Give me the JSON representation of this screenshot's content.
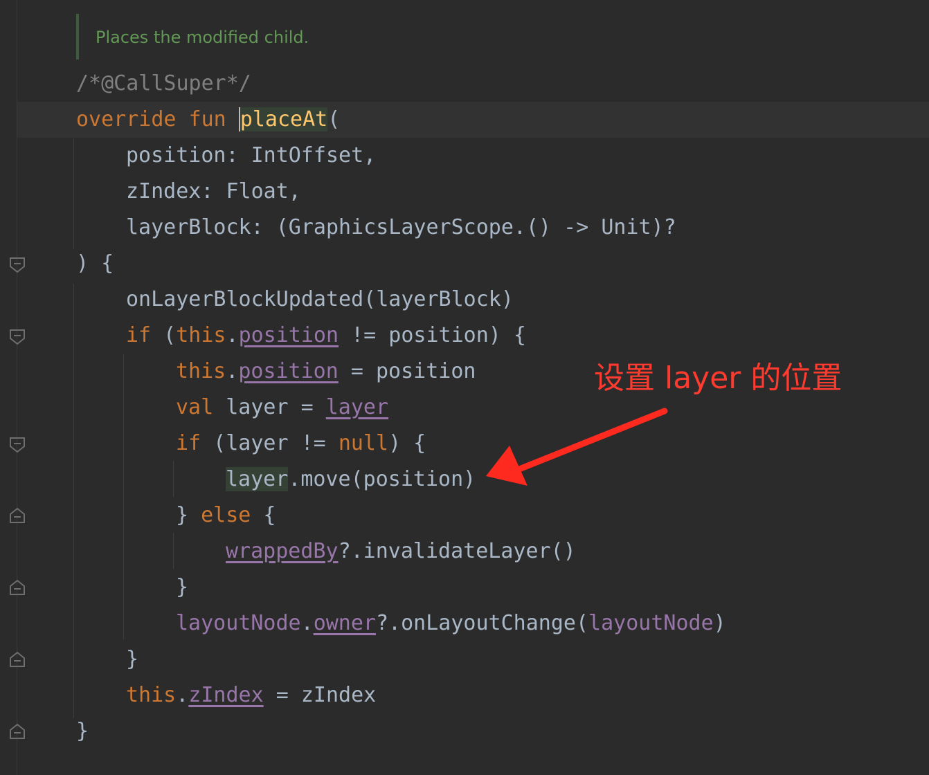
{
  "doc": {
    "text": "Places the modified child."
  },
  "code": {
    "l1_comment": "/*@CallSuper*/",
    "l2_kw1": "override",
    "l2_kw2": "fun",
    "l2_fn": "placeAt",
    "l2_paren": "(",
    "l3": "position: IntOffset,",
    "l4": "zIndex: Float,",
    "l5": "layerBlock: (GraphicsLayerScope.() -> Unit)?",
    "l6": ") {",
    "l7": "onLayerBlockUpdated(layerBlock)",
    "l8_if": "if",
    "l8_paren": " (",
    "l8_this": "this",
    "l8_dot": ".",
    "l8_prop": "position",
    "l8_rest": " != position) {",
    "l9_this": "this",
    "l9_dot": ".",
    "l9_prop": "position",
    "l9_rest": " = position",
    "l10_val": "val",
    "l10_mid": " layer = ",
    "l10_prop": "layer",
    "l11_if": "if",
    "l11_mid": " (layer != ",
    "l11_null": "null",
    "l11_rest": ") {",
    "l12_layer": "layer",
    "l12_rest": ".move(position)",
    "l13_brace": "} ",
    "l13_else": "else",
    "l13_rest": " {",
    "l14_prop": "wrappedBy",
    "l14_rest": "?.invalidateLayer()",
    "l15": "}",
    "l16_p1": "layoutNode",
    "l16_dot": ".",
    "l16_p2": "owner",
    "l16_mid": "?.onLayoutChange(",
    "l16_p3": "layoutNode",
    "l16_end": ")",
    "l17": "}",
    "l18_this": "this",
    "l18_dot": ".",
    "l18_prop": "zIndex",
    "l18_rest": " = zIndex",
    "l19": "}"
  },
  "annotation": {
    "text": "设置 layer 的位置",
    "color": "#ff3b30"
  },
  "colors": {
    "background": "#2b2b2b",
    "keyword": "#cc7832",
    "function": "#ffc66d",
    "property": "#9876aa",
    "comment": "#808080",
    "doc": "#629755",
    "text": "#a9b7c6"
  }
}
